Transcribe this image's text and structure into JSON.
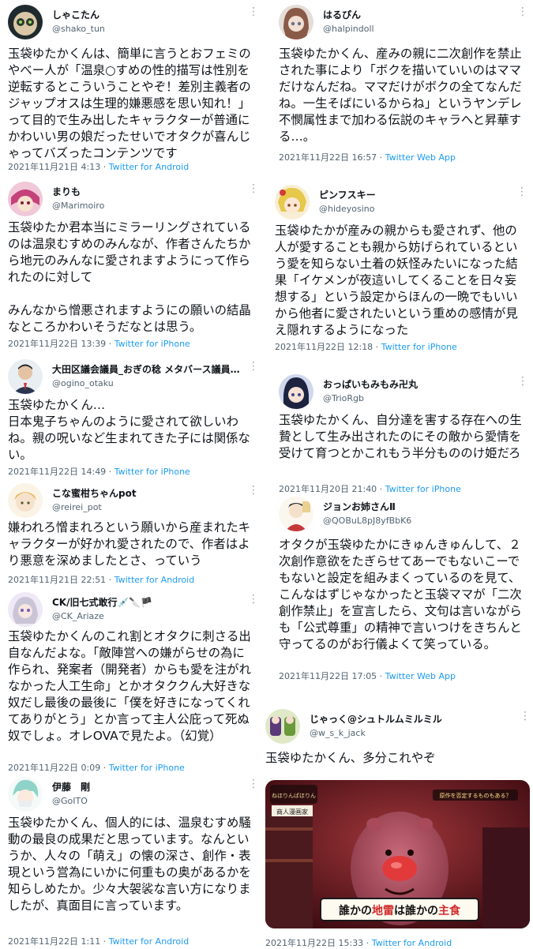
{
  "tweets": [
    {
      "name": "しゃこたん",
      "handle": "@shako_tun",
      "body": "玉袋ゆたかくんは、簡単に言うとおフェミのやべー人が「温泉○すめの性的描写は性別を逆転するとこういうことやぞ！差別主義者のジャップオスは生理的嫌悪感を思い知れ！」って目的で生み出したキャラクターが普通にかわいい男の娘だったせいでオタクが喜んじゃってバズったコンテンツです",
      "date": "2021年11月21日 4:13",
      "sep": " · ",
      "source": "Twitter for Android",
      "avatar_color": "#1f2a2e"
    },
    {
      "name": "まりも",
      "handle": "@Marimoiro",
      "body": "玉袋ゆたか君本当にミラーリングされているのは温泉むすめのみんなが、作者さんたちから地元のみんなに愛されますようにって作られたのに対して\n\nみんなから憎悪されますようにの願いの結晶なところかわいそうだなとは思う。",
      "date": "2021年11月22日 13:39",
      "sep": " · ",
      "source": "Twitter for iPhone",
      "avatar_color": "#c4417a"
    },
    {
      "name": "大田区議会議員_おぎの稔 メタバース議員…",
      "handle": "@ogino_otaku",
      "body": "玉袋ゆたかくん…\n日本鬼子ちゃんのように愛されて欲しいわね。親の呪いなど生まれてきた子には関係ない。",
      "date": "2021年11月22日 14:49",
      "sep": " · ",
      "source": "Twitter for iPhone",
      "avatar_color": "#4a5a6a"
    },
    {
      "name": "こな蜜柑ちゃんpot",
      "handle": "@reirei_pot",
      "body": "嫌われろ憎まれろという願いから産まれたキャラクターが好かれ愛されたので、作者はより悪意を深めましたとさ、っていう",
      "date": "2021年11月21日 22:51",
      "sep": " · ",
      "source": "Twitter for Android",
      "avatar_color": "#e8d7a8"
    },
    {
      "name": "CK/旧七式敢行💉🔪🏴",
      "handle": "@CK_Ariaze",
      "body": "玉袋ゆたかくんのこれ割とオタクに刺さる出自なんだよな。「敵陣営への嫌がらせの為に作られ、発案者（開発者）からも愛を注がれなかった人工生命」とかオタククん大好きな奴だし最後の最後に「僕を好きになってくれてありがとう」とか言って主人公庇って死ぬ奴でしょ。オレOVAで見たよ。（幻覚）",
      "date": "2021年11月22日 0:09",
      "sep": " · ",
      "source": "Twitter for iPhone",
      "avatar_color": "#7a5ab0"
    },
    {
      "name": "伊藤　剛",
      "handle": "@GoITO",
      "body": "玉袋ゆたかくん、個人的には、温泉むすめ騒動の最良の成果だと思っています。なんというか、人々の「萌え」の懐の深さ、創作・表現という営為にいかに何重もの奥があるかを知らしめたか。少々大袈裟な言い方になりましたが、真面目に言っています。",
      "date": "2021年11月22日 1:11",
      "sep": " · ",
      "source": "Twitter for Android",
      "avatar_color": "#8fd3c8"
    },
    {
      "name": "はるぴん",
      "handle": "@halpindoll",
      "body": "玉袋ゆたかくん、産みの親に二次創作を禁止された事により「ボクを描いていいのはママだけなんだね。ママだけがボクの全てなんだね。一生そばにいるからね」というヤンデレ不憫属性まで加わる伝説のキャラへと昇華する…。",
      "date": "2021年11月22日 16:57",
      "sep": " · ",
      "source": "Twitter Web App",
      "avatar_color": "#b89a8a"
    },
    {
      "name": "ピンフスキー",
      "handle": "@hideyosino",
      "body": "玉袋ゆたかが産みの親からも愛されず、他の人が愛することも親から妨げられているという愛を知らない土着の妖怪みたいになった結果「イケメンが夜這いしてくることを日々妄想する」という設定からほんの一晩でもいいから他者に愛されたいという重めの感情が見え隠れするようになった",
      "date": "2021年11月22日 12:18",
      "sep": " · ",
      "source": "Twitter for iPhone",
      "avatar_color": "#e6c84a"
    },
    {
      "name": "おっぱいもみもみ卍丸",
      "handle": "@TrioRgb",
      "body": "玉袋ゆたかくん、自分達を害する存在への生贄として生み出されたのにその敵から愛情を受けて育つとかこれもう半分もののけ姫だろ",
      "date": "2021年11月20日 21:40",
      "sep": " · ",
      "source": "Twitter for iPhone",
      "avatar_color": "#3a4a8a"
    },
    {
      "name": "ジョンお姉さんⅡ",
      "handle": "@QOBuL8pJ8yfBbK6",
      "body": "オタクが玉袋ゆたかにきゅんきゅんして、２次創作意欲をたぎらせてあーでもないこーでもないと設定を組みまくっているのを見て、こんなはずじゃなかったと玉袋ママが「二次創作禁止」を宣言したら、文句は言いながらも「公式尊重」の精神で言いつけをきちんと守ってるのがお行儀よくて笑っている。",
      "date": "2021年11月22日 17:05",
      "sep": " · ",
      "source": "Twitter Web App",
      "avatar_color": "#d8c4a0"
    },
    {
      "name": "じゃっく@シュトルムミルミル",
      "handle": "@w_s_k_jack",
      "body": "玉袋ゆたかくん、多分これやぞ",
      "date": "2021年11月22日 15:33",
      "sep": " · ",
      "source": "Twitter for Android",
      "avatar_color": "#6a9a3a"
    }
  ],
  "tv": {
    "logo": "ねほりんぱほりん",
    "nameplate": "商人漫画家",
    "topic": "原作を否定するものもある？",
    "caption_a": "誰かの",
    "caption_b": "地雷",
    "caption_c": "は誰かの",
    "caption_d": "主食"
  }
}
